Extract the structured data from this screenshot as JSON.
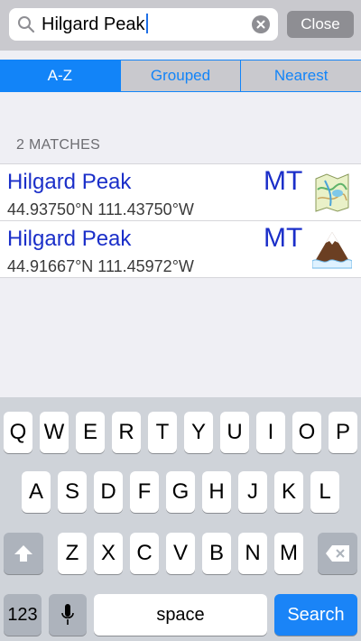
{
  "search": {
    "query": "Hilgard Peak",
    "close_label": "Close"
  },
  "tabs": [
    {
      "label": "A-Z",
      "active": true
    },
    {
      "label": "Grouped",
      "active": false
    },
    {
      "label": "Nearest",
      "active": false
    }
  ],
  "results_header": "2 MATCHES",
  "results": [
    {
      "name": "Hilgard Peak",
      "coords": "44.93750°N 111.43750°W",
      "state": "MT",
      "icon": "topo-map-icon"
    },
    {
      "name": "Hilgard Peak",
      "coords": "44.91667°N 111.45972°W",
      "state": "MT",
      "icon": "mountain-peak-icon"
    }
  ],
  "keyboard": {
    "row1": [
      "Q",
      "W",
      "E",
      "R",
      "T",
      "Y",
      "U",
      "I",
      "O",
      "P"
    ],
    "row2": [
      "A",
      "S",
      "D",
      "F",
      "G",
      "H",
      "J",
      "K",
      "L"
    ],
    "row3": [
      "Z",
      "X",
      "C",
      "V",
      "B",
      "N",
      "M"
    ],
    "numbers_label": "123",
    "space_label": "space",
    "search_label": "Search"
  },
  "colors": {
    "accent": "#1284f8",
    "result_text": "#1b2fc9",
    "search_key": "#1a84f7"
  }
}
